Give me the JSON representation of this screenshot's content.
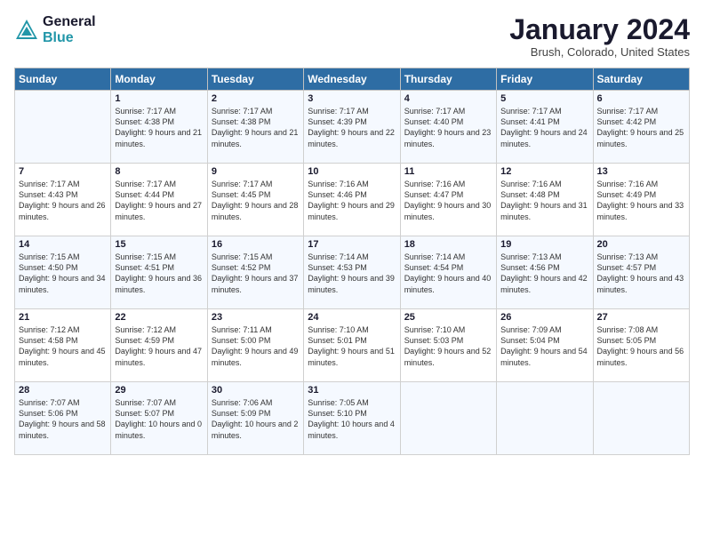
{
  "header": {
    "logo_line1": "General",
    "logo_line2": "Blue",
    "month": "January 2024",
    "location": "Brush, Colorado, United States"
  },
  "days_of_week": [
    "Sunday",
    "Monday",
    "Tuesday",
    "Wednesday",
    "Thursday",
    "Friday",
    "Saturday"
  ],
  "weeks": [
    [
      {
        "day": "",
        "sunrise": "",
        "sunset": "",
        "daylight": ""
      },
      {
        "day": "1",
        "sunrise": "Sunrise: 7:17 AM",
        "sunset": "Sunset: 4:38 PM",
        "daylight": "Daylight: 9 hours and 21 minutes."
      },
      {
        "day": "2",
        "sunrise": "Sunrise: 7:17 AM",
        "sunset": "Sunset: 4:38 PM",
        "daylight": "Daylight: 9 hours and 21 minutes."
      },
      {
        "day": "3",
        "sunrise": "Sunrise: 7:17 AM",
        "sunset": "Sunset: 4:39 PM",
        "daylight": "Daylight: 9 hours and 22 minutes."
      },
      {
        "day": "4",
        "sunrise": "Sunrise: 7:17 AM",
        "sunset": "Sunset: 4:40 PM",
        "daylight": "Daylight: 9 hours and 23 minutes."
      },
      {
        "day": "5",
        "sunrise": "Sunrise: 7:17 AM",
        "sunset": "Sunset: 4:41 PM",
        "daylight": "Daylight: 9 hours and 24 minutes."
      },
      {
        "day": "6",
        "sunrise": "Sunrise: 7:17 AM",
        "sunset": "Sunset: 4:42 PM",
        "daylight": "Daylight: 9 hours and 25 minutes."
      }
    ],
    [
      {
        "day": "7",
        "sunrise": "Sunrise: 7:17 AM",
        "sunset": "Sunset: 4:43 PM",
        "daylight": "Daylight: 9 hours and 26 minutes."
      },
      {
        "day": "8",
        "sunrise": "Sunrise: 7:17 AM",
        "sunset": "Sunset: 4:44 PM",
        "daylight": "Daylight: 9 hours and 27 minutes."
      },
      {
        "day": "9",
        "sunrise": "Sunrise: 7:17 AM",
        "sunset": "Sunset: 4:45 PM",
        "daylight": "Daylight: 9 hours and 28 minutes."
      },
      {
        "day": "10",
        "sunrise": "Sunrise: 7:16 AM",
        "sunset": "Sunset: 4:46 PM",
        "daylight": "Daylight: 9 hours and 29 minutes."
      },
      {
        "day": "11",
        "sunrise": "Sunrise: 7:16 AM",
        "sunset": "Sunset: 4:47 PM",
        "daylight": "Daylight: 9 hours and 30 minutes."
      },
      {
        "day": "12",
        "sunrise": "Sunrise: 7:16 AM",
        "sunset": "Sunset: 4:48 PM",
        "daylight": "Daylight: 9 hours and 31 minutes."
      },
      {
        "day": "13",
        "sunrise": "Sunrise: 7:16 AM",
        "sunset": "Sunset: 4:49 PM",
        "daylight": "Daylight: 9 hours and 33 minutes."
      }
    ],
    [
      {
        "day": "14",
        "sunrise": "Sunrise: 7:15 AM",
        "sunset": "Sunset: 4:50 PM",
        "daylight": "Daylight: 9 hours and 34 minutes."
      },
      {
        "day": "15",
        "sunrise": "Sunrise: 7:15 AM",
        "sunset": "Sunset: 4:51 PM",
        "daylight": "Daylight: 9 hours and 36 minutes."
      },
      {
        "day": "16",
        "sunrise": "Sunrise: 7:15 AM",
        "sunset": "Sunset: 4:52 PM",
        "daylight": "Daylight: 9 hours and 37 minutes."
      },
      {
        "day": "17",
        "sunrise": "Sunrise: 7:14 AM",
        "sunset": "Sunset: 4:53 PM",
        "daylight": "Daylight: 9 hours and 39 minutes."
      },
      {
        "day": "18",
        "sunrise": "Sunrise: 7:14 AM",
        "sunset": "Sunset: 4:54 PM",
        "daylight": "Daylight: 9 hours and 40 minutes."
      },
      {
        "day": "19",
        "sunrise": "Sunrise: 7:13 AM",
        "sunset": "Sunset: 4:56 PM",
        "daylight": "Daylight: 9 hours and 42 minutes."
      },
      {
        "day": "20",
        "sunrise": "Sunrise: 7:13 AM",
        "sunset": "Sunset: 4:57 PM",
        "daylight": "Daylight: 9 hours and 43 minutes."
      }
    ],
    [
      {
        "day": "21",
        "sunrise": "Sunrise: 7:12 AM",
        "sunset": "Sunset: 4:58 PM",
        "daylight": "Daylight: 9 hours and 45 minutes."
      },
      {
        "day": "22",
        "sunrise": "Sunrise: 7:12 AM",
        "sunset": "Sunset: 4:59 PM",
        "daylight": "Daylight: 9 hours and 47 minutes."
      },
      {
        "day": "23",
        "sunrise": "Sunrise: 7:11 AM",
        "sunset": "Sunset: 5:00 PM",
        "daylight": "Daylight: 9 hours and 49 minutes."
      },
      {
        "day": "24",
        "sunrise": "Sunrise: 7:10 AM",
        "sunset": "Sunset: 5:01 PM",
        "daylight": "Daylight: 9 hours and 51 minutes."
      },
      {
        "day": "25",
        "sunrise": "Sunrise: 7:10 AM",
        "sunset": "Sunset: 5:03 PM",
        "daylight": "Daylight: 9 hours and 52 minutes."
      },
      {
        "day": "26",
        "sunrise": "Sunrise: 7:09 AM",
        "sunset": "Sunset: 5:04 PM",
        "daylight": "Daylight: 9 hours and 54 minutes."
      },
      {
        "day": "27",
        "sunrise": "Sunrise: 7:08 AM",
        "sunset": "Sunset: 5:05 PM",
        "daylight": "Daylight: 9 hours and 56 minutes."
      }
    ],
    [
      {
        "day": "28",
        "sunrise": "Sunrise: 7:07 AM",
        "sunset": "Sunset: 5:06 PM",
        "daylight": "Daylight: 9 hours and 58 minutes."
      },
      {
        "day": "29",
        "sunrise": "Sunrise: 7:07 AM",
        "sunset": "Sunset: 5:07 PM",
        "daylight": "Daylight: 10 hours and 0 minutes."
      },
      {
        "day": "30",
        "sunrise": "Sunrise: 7:06 AM",
        "sunset": "Sunset: 5:09 PM",
        "daylight": "Daylight: 10 hours and 2 minutes."
      },
      {
        "day": "31",
        "sunrise": "Sunrise: 7:05 AM",
        "sunset": "Sunset: 5:10 PM",
        "daylight": "Daylight: 10 hours and 4 minutes."
      },
      {
        "day": "",
        "sunrise": "",
        "sunset": "",
        "daylight": ""
      },
      {
        "day": "",
        "sunrise": "",
        "sunset": "",
        "daylight": ""
      },
      {
        "day": "",
        "sunrise": "",
        "sunset": "",
        "daylight": ""
      }
    ]
  ]
}
